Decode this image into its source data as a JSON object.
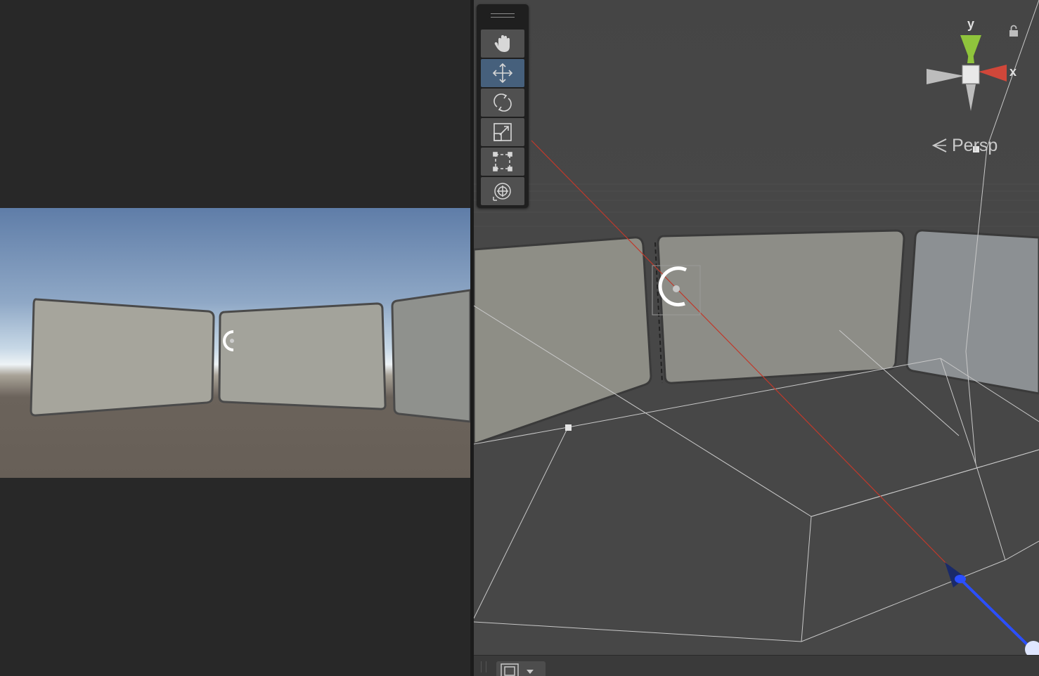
{
  "game_view": {
    "sky_top": "#5f7da8",
    "horizon": "#dce7ee",
    "ground": "#675f57"
  },
  "scene_view": {
    "projection_label": "Persp",
    "gizmo": {
      "y_label": "y",
      "x_label": "x"
    },
    "axis_colors": {
      "x": "#d0473a",
      "y": "#8fc43c",
      "z": "#2b4fff"
    }
  },
  "tool_palette": {
    "tools": [
      {
        "name": "hand-tool",
        "icon": "hand-icon",
        "active": false
      },
      {
        "name": "move-tool",
        "icon": "move-icon",
        "active": true
      },
      {
        "name": "rotate-tool",
        "icon": "rotate-icon",
        "active": false
      },
      {
        "name": "scale-tool",
        "icon": "scale-icon",
        "active": false
      },
      {
        "name": "rect-tool",
        "icon": "rect-transform-icon",
        "active": false
      },
      {
        "name": "transform-tool",
        "icon": "transform-icon",
        "active": false
      }
    ],
    "active_color": "#46607c"
  }
}
